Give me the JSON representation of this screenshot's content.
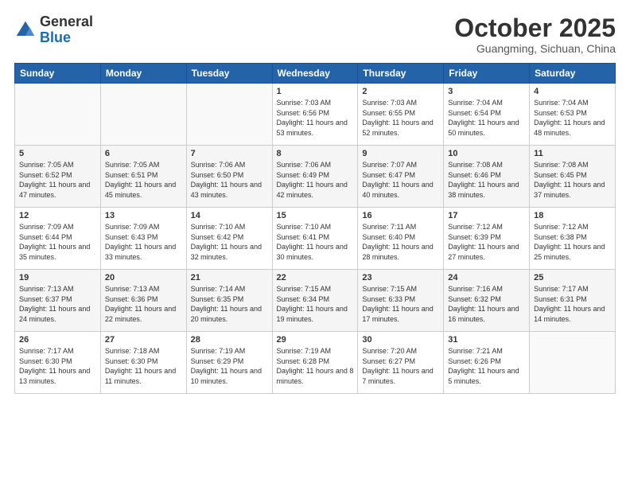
{
  "logo": {
    "line1": "General",
    "line2": "Blue"
  },
  "header": {
    "month": "October 2025",
    "location": "Guangming, Sichuan, China"
  },
  "weekdays": [
    "Sunday",
    "Monday",
    "Tuesday",
    "Wednesday",
    "Thursday",
    "Friday",
    "Saturday"
  ],
  "weeks": [
    [
      {
        "day": "",
        "info": ""
      },
      {
        "day": "",
        "info": ""
      },
      {
        "day": "",
        "info": ""
      },
      {
        "day": "1",
        "info": "Sunrise: 7:03 AM\nSunset: 6:56 PM\nDaylight: 11 hours\nand 53 minutes."
      },
      {
        "day": "2",
        "info": "Sunrise: 7:03 AM\nSunset: 6:55 PM\nDaylight: 11 hours\nand 52 minutes."
      },
      {
        "day": "3",
        "info": "Sunrise: 7:04 AM\nSunset: 6:54 PM\nDaylight: 11 hours\nand 50 minutes."
      },
      {
        "day": "4",
        "info": "Sunrise: 7:04 AM\nSunset: 6:53 PM\nDaylight: 11 hours\nand 48 minutes."
      }
    ],
    [
      {
        "day": "5",
        "info": "Sunrise: 7:05 AM\nSunset: 6:52 PM\nDaylight: 11 hours\nand 47 minutes."
      },
      {
        "day": "6",
        "info": "Sunrise: 7:05 AM\nSunset: 6:51 PM\nDaylight: 11 hours\nand 45 minutes."
      },
      {
        "day": "7",
        "info": "Sunrise: 7:06 AM\nSunset: 6:50 PM\nDaylight: 11 hours\nand 43 minutes."
      },
      {
        "day": "8",
        "info": "Sunrise: 7:06 AM\nSunset: 6:49 PM\nDaylight: 11 hours\nand 42 minutes."
      },
      {
        "day": "9",
        "info": "Sunrise: 7:07 AM\nSunset: 6:47 PM\nDaylight: 11 hours\nand 40 minutes."
      },
      {
        "day": "10",
        "info": "Sunrise: 7:08 AM\nSunset: 6:46 PM\nDaylight: 11 hours\nand 38 minutes."
      },
      {
        "day": "11",
        "info": "Sunrise: 7:08 AM\nSunset: 6:45 PM\nDaylight: 11 hours\nand 37 minutes."
      }
    ],
    [
      {
        "day": "12",
        "info": "Sunrise: 7:09 AM\nSunset: 6:44 PM\nDaylight: 11 hours\nand 35 minutes."
      },
      {
        "day": "13",
        "info": "Sunrise: 7:09 AM\nSunset: 6:43 PM\nDaylight: 11 hours\nand 33 minutes."
      },
      {
        "day": "14",
        "info": "Sunrise: 7:10 AM\nSunset: 6:42 PM\nDaylight: 11 hours\nand 32 minutes."
      },
      {
        "day": "15",
        "info": "Sunrise: 7:10 AM\nSunset: 6:41 PM\nDaylight: 11 hours\nand 30 minutes."
      },
      {
        "day": "16",
        "info": "Sunrise: 7:11 AM\nSunset: 6:40 PM\nDaylight: 11 hours\nand 28 minutes."
      },
      {
        "day": "17",
        "info": "Sunrise: 7:12 AM\nSunset: 6:39 PM\nDaylight: 11 hours\nand 27 minutes."
      },
      {
        "day": "18",
        "info": "Sunrise: 7:12 AM\nSunset: 6:38 PM\nDaylight: 11 hours\nand 25 minutes."
      }
    ],
    [
      {
        "day": "19",
        "info": "Sunrise: 7:13 AM\nSunset: 6:37 PM\nDaylight: 11 hours\nand 24 minutes."
      },
      {
        "day": "20",
        "info": "Sunrise: 7:13 AM\nSunset: 6:36 PM\nDaylight: 11 hours\nand 22 minutes."
      },
      {
        "day": "21",
        "info": "Sunrise: 7:14 AM\nSunset: 6:35 PM\nDaylight: 11 hours\nand 20 minutes."
      },
      {
        "day": "22",
        "info": "Sunrise: 7:15 AM\nSunset: 6:34 PM\nDaylight: 11 hours\nand 19 minutes."
      },
      {
        "day": "23",
        "info": "Sunrise: 7:15 AM\nSunset: 6:33 PM\nDaylight: 11 hours\nand 17 minutes."
      },
      {
        "day": "24",
        "info": "Sunrise: 7:16 AM\nSunset: 6:32 PM\nDaylight: 11 hours\nand 16 minutes."
      },
      {
        "day": "25",
        "info": "Sunrise: 7:17 AM\nSunset: 6:31 PM\nDaylight: 11 hours\nand 14 minutes."
      }
    ],
    [
      {
        "day": "26",
        "info": "Sunrise: 7:17 AM\nSunset: 6:30 PM\nDaylight: 11 hours\nand 13 minutes."
      },
      {
        "day": "27",
        "info": "Sunrise: 7:18 AM\nSunset: 6:30 PM\nDaylight: 11 hours\nand 11 minutes."
      },
      {
        "day": "28",
        "info": "Sunrise: 7:19 AM\nSunset: 6:29 PM\nDaylight: 11 hours\nand 10 minutes."
      },
      {
        "day": "29",
        "info": "Sunrise: 7:19 AM\nSunset: 6:28 PM\nDaylight: 11 hours\nand 8 minutes."
      },
      {
        "day": "30",
        "info": "Sunrise: 7:20 AM\nSunset: 6:27 PM\nDaylight: 11 hours\nand 7 minutes."
      },
      {
        "day": "31",
        "info": "Sunrise: 7:21 AM\nSunset: 6:26 PM\nDaylight: 11 hours\nand 5 minutes."
      },
      {
        "day": "",
        "info": ""
      }
    ]
  ]
}
